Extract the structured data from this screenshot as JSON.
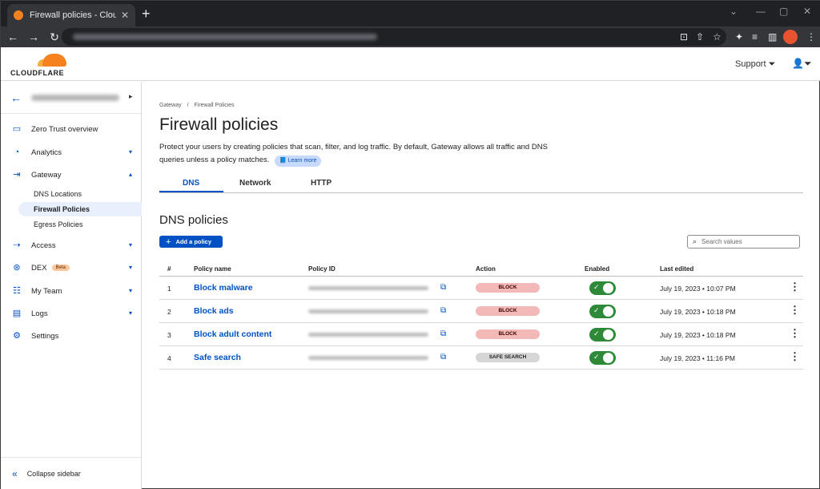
{
  "browser": {
    "tab_title": "Firewall policies - Cloudflare Zero",
    "close_glyph": "✕",
    "new_tab_glyph": "+",
    "window_controls": [
      "⌄",
      "—",
      "▢",
      "✕"
    ],
    "nav": {
      "back": "←",
      "forward": "→",
      "reload": "↻"
    },
    "toolbar_icons": [
      "⊡",
      "⇧",
      "☆",
      "✦",
      "≡",
      "▥",
      "⋮"
    ]
  },
  "header": {
    "logo": "CLOUDFLARE",
    "support": "Support ⏷",
    "user_menu": "👤⏷"
  },
  "sidebar": {
    "back_glyph": "←",
    "account_caret": "▸",
    "items": [
      {
        "label": "Zero Trust overview",
        "icon": "▭"
      },
      {
        "label": "Analytics",
        "icon": "◔",
        "caret": "▾"
      },
      {
        "label": "Gateway",
        "icon": "⇥",
        "caret": "▴"
      },
      {
        "label": "Access",
        "icon": "⇢",
        "caret": "▾"
      },
      {
        "label": "DEX",
        "icon": "⊛",
        "caret": "▾",
        "badge": "Beta"
      },
      {
        "label": "My Team",
        "icon": "☷",
        "caret": "▾"
      },
      {
        "label": "Logs",
        "icon": "▤",
        "caret": "▾"
      },
      {
        "label": "Settings",
        "icon": "⚙"
      }
    ],
    "gateway_sub": [
      "DNS Locations",
      "Firewall Policies",
      "Egress Policies"
    ],
    "collapse_glyph": "«",
    "collapse": "Collapse sidebar"
  },
  "main": {
    "breadcrumb": [
      "Gateway",
      "/",
      "Firewall Policies"
    ],
    "title": "Firewall policies",
    "description": "Protect your users by creating policies that scan, filter, and log traffic. By default, Gateway allows all traffic and DNS queries unless a policy matches.",
    "learn_more": "📘 Learn more",
    "tabs": [
      "DNS",
      "Network",
      "HTTP"
    ],
    "section_title": "DNS policies",
    "add_plus": "+",
    "add_button": "Add a policy",
    "search_icon": "⌕",
    "search_placeholder": "Search values",
    "columns": [
      "#",
      "Policy name",
      "Policy ID",
      "Action",
      "Enabled",
      "Last edited"
    ],
    "copy_glyph": "⧉",
    "check_glyph": "✓",
    "kebab_glyph": "⋮",
    "policies": [
      {
        "num": "1",
        "name": "Block malware",
        "action": "BLOCK",
        "enabled": true,
        "edited": "July 19, 2023 • 10:07 PM"
      },
      {
        "num": "2",
        "name": "Block ads",
        "action": "BLOCK",
        "enabled": true,
        "edited": "July 19, 2023 • 10:18 PM"
      },
      {
        "num": "3",
        "name": "Block adult content",
        "action": "BLOCK",
        "enabled": true,
        "edited": "July 19, 2023 • 10:18 PM"
      },
      {
        "num": "4",
        "name": "Safe search",
        "action": "SAFE SEARCH",
        "enabled": true,
        "edited": "July 19, 2023 • 11:16 PM"
      }
    ]
  },
  "colors": {
    "accent": "#0051c3",
    "brand": "#f6821f",
    "enabled": "#2e8a39",
    "block": "#f3b8b8"
  }
}
